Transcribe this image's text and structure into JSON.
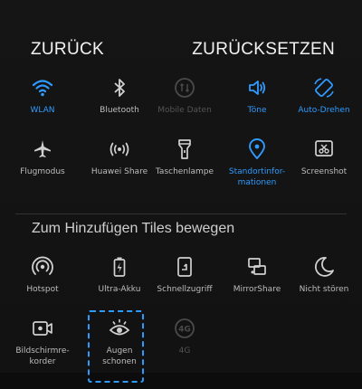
{
  "header": {
    "back_label": "ZURÜCK",
    "reset_label": "ZURÜCKSETZEN"
  },
  "active_tiles": [
    {
      "label": "WLAN",
      "icon": "wifi-icon",
      "state": "active"
    },
    {
      "label": "Bluetooth",
      "icon": "bluetooth-icon",
      "state": "inactive"
    },
    {
      "label": "Mobile Daten",
      "icon": "mobile-data-icon",
      "state": "disabled"
    },
    {
      "label": "Töne",
      "icon": "sound-icon",
      "state": "active"
    },
    {
      "label": "Auto-Drehen",
      "icon": "auto-rotate-icon",
      "state": "active"
    },
    {
      "label": "Flugmodus",
      "icon": "airplane-icon",
      "state": "inactive"
    },
    {
      "label": "Huawei Share",
      "icon": "huawei-share-icon",
      "state": "inactive"
    },
    {
      "label": "Taschenlampe",
      "icon": "flashlight-icon",
      "state": "inactive"
    },
    {
      "label_line1": "Standortinfor-",
      "label_line2": "mationen",
      "icon": "location-icon",
      "state": "active"
    },
    {
      "label": "Screenshot",
      "icon": "screenshot-icon",
      "state": "inactive"
    }
  ],
  "add_section": {
    "title": "Zum Hinzufügen Tiles bewegen"
  },
  "available_tiles": [
    {
      "label": "Hotspot",
      "icon": "hotspot-icon",
      "state": "inactive"
    },
    {
      "label": "Ultra-Akku",
      "icon": "battery-icon",
      "state": "inactive"
    },
    {
      "label": "Schnellzugriff",
      "icon": "shortcut-icon",
      "state": "inactive"
    },
    {
      "label": "MirrorShare",
      "icon": "mirror-share-icon",
      "state": "inactive"
    },
    {
      "label": "Nicht stören",
      "icon": "moon-icon",
      "state": "inactive"
    },
    {
      "label_line1": "Bildschirmre-",
      "label_line2": "korder",
      "icon": "screen-recorder-icon",
      "state": "inactive"
    },
    {
      "label_line1": "Augen",
      "label_line2": "schonen",
      "icon": "eye-comfort-icon",
      "state": "inactive"
    },
    {
      "label": "4G",
      "icon": "4g-icon",
      "state": "disabled"
    }
  ],
  "colors": {
    "accent": "#2f9bff",
    "icon_inactive": "#d0d0d0",
    "icon_disabled": "#4a4a4a",
    "background": "#121212"
  }
}
